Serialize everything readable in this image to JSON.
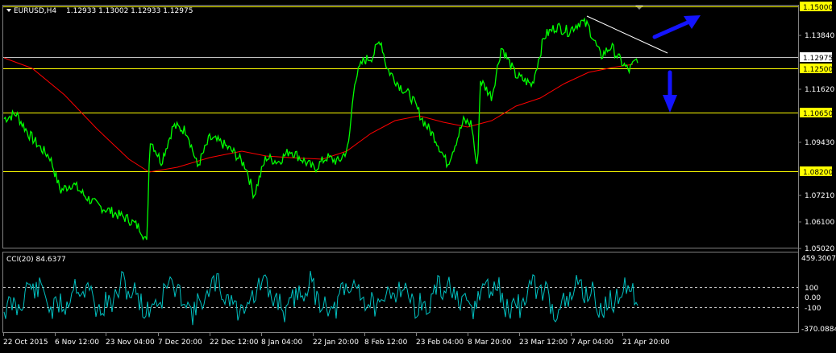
{
  "header": {
    "symbol": "EURUSD,H4",
    "ohlc": "1.12933 1.13002 1.12933 1.12975"
  },
  "indicator": {
    "title": "CCI(20) 84.6377",
    "levels": [
      "459.3007",
      "100",
      "0.00",
      "-100",
      "-370.0884"
    ]
  },
  "price_axis": {
    "labels": [
      "1.13840",
      "1.11620",
      "1.09430",
      "1.07210",
      "1.06100",
      "1.05020"
    ]
  },
  "level_boxes": [
    "1.15000",
    "1.12975",
    "1.12500",
    "1.10650",
    "1.08200"
  ],
  "time_axis": {
    "labels": [
      "22 Oct 2015",
      "6 Nov 12:00",
      "23 Nov 04:00",
      "7 Dec 20:00",
      "22 Dec 12:00",
      "8 Jan 04:00",
      "22 Jan 20:00",
      "8 Feb 12:00",
      "23 Feb 04:00",
      "8 Mar 20:00",
      "23 Mar 12:00",
      "7 Apr 04:00",
      "21 Apr 20:00"
    ]
  },
  "colors": {
    "background": "#000000",
    "price": "#00ff00",
    "moving_average": "#ff0000",
    "level_line": "#ffff00",
    "level_box": "#ffff00",
    "current_price_line": "#c0c0c0",
    "cci": "#00c0c0",
    "arrow": "#1414ff",
    "trendline": "#ffffff"
  },
  "chart_data": {
    "type": "line",
    "title": "EURUSD,H4",
    "y_range": [
      1.0502,
      1.15
    ],
    "series": [
      {
        "name": "EURUSD,H4",
        "x": [
          "22 Oct 2015",
          "6 Nov 12:00",
          "23 Nov 04:00",
          "7 Dec 20:00",
          "22 Dec 12:00",
          "8 Jan 04:00",
          "22 Jan 20:00",
          "8 Feb 12:00",
          "23 Feb 04:00",
          "8 Mar 20:00",
          "23 Mar 12:00",
          "7 Apr 04:00",
          "21 Apr 20:00"
        ],
        "values": [
          1.105,
          1.084,
          1.062,
          1.086,
          1.094,
          1.088,
          1.084,
          1.13,
          1.104,
          1.11,
          1.135,
          1.14,
          1.1298
        ]
      }
    ],
    "horizontal_levels": [
      1.15,
      1.125,
      1.1065,
      1.082
    ],
    "current_price": 1.12975
  }
}
